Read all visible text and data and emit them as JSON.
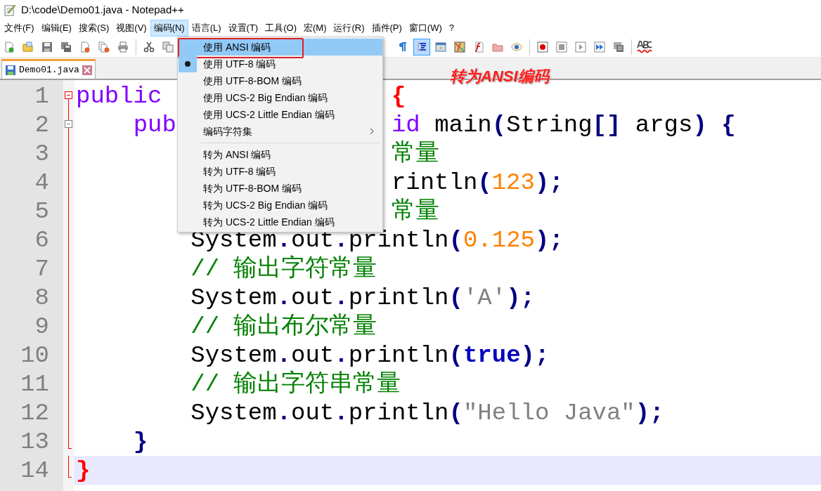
{
  "window": {
    "title": "D:\\code\\Demo01.java - Notepad++"
  },
  "menu_bar": [
    {
      "label": "文件(F)",
      "selected": false
    },
    {
      "label": "编辑(E)",
      "selected": false
    },
    {
      "label": "搜索(S)",
      "selected": false
    },
    {
      "label": "视图(V)",
      "selected": false
    },
    {
      "label": "编码(N)",
      "selected": true
    },
    {
      "label": "语言(L)",
      "selected": false
    },
    {
      "label": "设置(T)",
      "selected": false
    },
    {
      "label": "工具(O)",
      "selected": false
    },
    {
      "label": "宏(M)",
      "selected": false
    },
    {
      "label": "运行(R)",
      "selected": false
    },
    {
      "label": "插件(P)",
      "selected": false
    },
    {
      "label": "窗口(W)",
      "selected": false
    },
    {
      "label": "?",
      "selected": false
    }
  ],
  "toolbar_left": [
    {
      "kind": "new"
    },
    {
      "kind": "open"
    },
    {
      "kind": "save"
    },
    {
      "kind": "save_all"
    },
    {
      "kind": "close"
    },
    {
      "kind": "close_all"
    },
    {
      "kind": "print"
    },
    {
      "kind": "divider"
    },
    {
      "kind": "cut"
    },
    {
      "kind": "copy"
    }
  ],
  "toolbar_right": [
    {
      "kind": "pilcrow",
      "on": false
    },
    {
      "kind": "indent_guide",
      "on": true
    },
    {
      "kind": "panel"
    },
    {
      "kind": "map"
    },
    {
      "kind": "function"
    },
    {
      "kind": "folder"
    },
    {
      "kind": "eye"
    },
    {
      "kind": "divider"
    },
    {
      "kind": "record"
    },
    {
      "kind": "stop"
    },
    {
      "kind": "play"
    },
    {
      "kind": "fast_forward"
    },
    {
      "kind": "save_macro"
    },
    {
      "kind": "divider"
    },
    {
      "kind": "spellcheck"
    }
  ],
  "tabs": [
    {
      "label": "Demo01.java",
      "selected": true
    }
  ],
  "annotation": {
    "text": "转为ANSI编码"
  },
  "editor": {
    "lines": [
      {
        "number": "1",
        "current": false,
        "kind": "fold_start",
        "tokens": [
          {
            "text": "public",
            "kind": "keyword"
          },
          {
            "text": "                {",
            "kind": "brace_match"
          }
        ]
      },
      {
        "number": "2",
        "current": false,
        "kind": "fold_start",
        "tokens": [
          {
            "text": "    pub",
            "kind": "keyword"
          },
          {
            "text": "               id",
            "kind": "keyword"
          },
          {
            "text": " main",
            "kind": "plain"
          },
          {
            "text": "(",
            "kind": "operator"
          },
          {
            "text": "String",
            "kind": "plain"
          },
          {
            "text": "[]",
            "kind": "operator"
          },
          {
            "text": " args",
            "kind": "plain"
          },
          {
            "text": ")",
            "kind": "operator"
          },
          {
            "text": " {",
            "kind": "operator"
          }
        ]
      },
      {
        "number": "3",
        "current": false,
        "kind": "fold_body",
        "tokens": [
          {
            "text": "                      常量",
            "kind": "comment"
          }
        ]
      },
      {
        "number": "4",
        "current": false,
        "kind": "fold_body",
        "tokens": [
          {
            "text": "                      rintln",
            "kind": "plain"
          },
          {
            "text": "(",
            "kind": "operator"
          },
          {
            "text": "123",
            "kind": "number"
          },
          {
            "text": ");",
            "kind": "operator"
          }
        ]
      },
      {
        "number": "5",
        "current": false,
        "kind": "fold_body",
        "tokens": [
          {
            "text": "                      常量",
            "kind": "comment"
          }
        ]
      },
      {
        "number": "6",
        "current": false,
        "kind": "fold_body",
        "tokens": [
          {
            "text": "        System",
            "kind": "plain"
          },
          {
            "text": ".",
            "kind": "operator"
          },
          {
            "text": "out",
            "kind": "plain"
          },
          {
            "text": ".",
            "kind": "operator"
          },
          {
            "text": "println",
            "kind": "plain"
          },
          {
            "text": "(",
            "kind": "operator"
          },
          {
            "text": "0.125",
            "kind": "number"
          },
          {
            "text": ");",
            "kind": "operator"
          }
        ]
      },
      {
        "number": "7",
        "current": false,
        "kind": "fold_body",
        "tokens": [
          {
            "text": "        // 输出字符常量",
            "kind": "comment"
          }
        ]
      },
      {
        "number": "8",
        "current": false,
        "kind": "fold_body",
        "tokens": [
          {
            "text": "        System",
            "kind": "plain"
          },
          {
            "text": ".",
            "kind": "operator"
          },
          {
            "text": "out",
            "kind": "plain"
          },
          {
            "text": ".",
            "kind": "operator"
          },
          {
            "text": "println",
            "kind": "plain"
          },
          {
            "text": "(",
            "kind": "operator"
          },
          {
            "text": "'A'",
            "kind": "string"
          },
          {
            "text": ");",
            "kind": "operator"
          }
        ]
      },
      {
        "number": "9",
        "current": false,
        "kind": "fold_body",
        "tokens": [
          {
            "text": "        // 输出布尔常量",
            "kind": "comment"
          }
        ]
      },
      {
        "number": "10",
        "current": false,
        "kind": "fold_body",
        "tokens": [
          {
            "text": "        System",
            "kind": "plain"
          },
          {
            "text": ".",
            "kind": "operator"
          },
          {
            "text": "out",
            "kind": "plain"
          },
          {
            "text": ".",
            "kind": "operator"
          },
          {
            "text": "println",
            "kind": "plain"
          },
          {
            "text": "(",
            "kind": "operator"
          },
          {
            "text": "true",
            "kind": "literal"
          },
          {
            "text": ");",
            "kind": "operator"
          }
        ]
      },
      {
        "number": "11",
        "current": false,
        "kind": "fold_body",
        "tokens": [
          {
            "text": "        // 输出字符串常量",
            "kind": "comment"
          }
        ]
      },
      {
        "number": "12",
        "current": false,
        "kind": "fold_body",
        "tokens": [
          {
            "text": "        System",
            "kind": "plain"
          },
          {
            "text": ".",
            "kind": "operator"
          },
          {
            "text": "out",
            "kind": "plain"
          },
          {
            "text": ".",
            "kind": "operator"
          },
          {
            "text": "println",
            "kind": "plain"
          },
          {
            "text": "(",
            "kind": "operator"
          },
          {
            "text": "\"Hello Java\"",
            "kind": "string"
          },
          {
            "text": ");",
            "kind": "operator"
          }
        ]
      },
      {
        "number": "13",
        "current": false,
        "kind": "fold_end",
        "tokens": [
          {
            "text": "    }",
            "kind": "operator"
          }
        ]
      },
      {
        "number": "14",
        "current": true,
        "kind": "fold_end",
        "tokens": [
          {
            "text": "}",
            "kind": "brace_match"
          }
        ]
      }
    ]
  },
  "dropdown": {
    "items": [
      {
        "kind": "option",
        "label": "使用 ANSI 编码",
        "highlighted": true,
        "checked": false,
        "outlined": true
      },
      {
        "kind": "option",
        "label": "使用 UTF-8 编码",
        "highlighted": false,
        "checked": true,
        "outlined": false
      },
      {
        "kind": "option",
        "label": "使用 UTF-8-BOM 编码",
        "highlighted": false,
        "checked": false,
        "outlined": false
      },
      {
        "kind": "option",
        "label": "使用 UCS-2 Big Endian 编码",
        "highlighted": false,
        "checked": false,
        "outlined": false
      },
      {
        "kind": "option",
        "label": "使用 UCS-2 Little Endian 编码",
        "highlighted": false,
        "checked": false,
        "outlined": false
      },
      {
        "kind": "submenu",
        "label": "编码字符集",
        "highlighted": false,
        "checked": false,
        "outlined": false
      },
      {
        "kind": "separator"
      },
      {
        "kind": "option",
        "label": "转为 ANSI 编码",
        "highlighted": false,
        "checked": false,
        "outlined": false
      },
      {
        "kind": "option",
        "label": "转为 UTF-8 编码",
        "highlighted": false,
        "checked": false,
        "outlined": false
      },
      {
        "kind": "option",
        "label": "转为 UTF-8-BOM 编码",
        "highlighted": false,
        "checked": false,
        "outlined": false
      },
      {
        "kind": "option",
        "label": "转为 UCS-2 Big Endian 编码",
        "highlighted": false,
        "checked": false,
        "outlined": false
      },
      {
        "kind": "option",
        "label": "转为 UCS-2 Little Endian 编码",
        "highlighted": false,
        "checked": false,
        "outlined": false
      }
    ]
  }
}
